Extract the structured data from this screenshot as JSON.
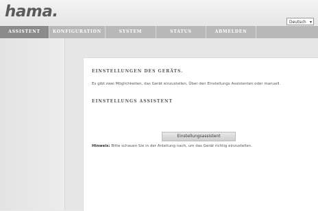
{
  "header": {
    "logo": "hama.",
    "language": "Deutsch"
  },
  "nav": {
    "tabs": [
      {
        "label": "ASSISTENT"
      },
      {
        "label": "KONFIGURATION"
      },
      {
        "label": "SYSTEM"
      },
      {
        "label": "STATUS"
      },
      {
        "label": "ABMELDEN"
      }
    ]
  },
  "content": {
    "heading1": "EINSTELLUNGEN DES GERÄTS.",
    "text1": "Es gibt zwei Möglichkeiten, das Gerät einzustellen. Über den Einstellungs Assistenten oder manuell.",
    "heading2": "EINSTELLUNGS ASSISTENT",
    "button": "Einstellungsassistent",
    "hint_label": "Hinweis:",
    "hint_text": " Bitte schauen Sie in der Anleitung nach, um das Gerät richtig einzustellen."
  }
}
